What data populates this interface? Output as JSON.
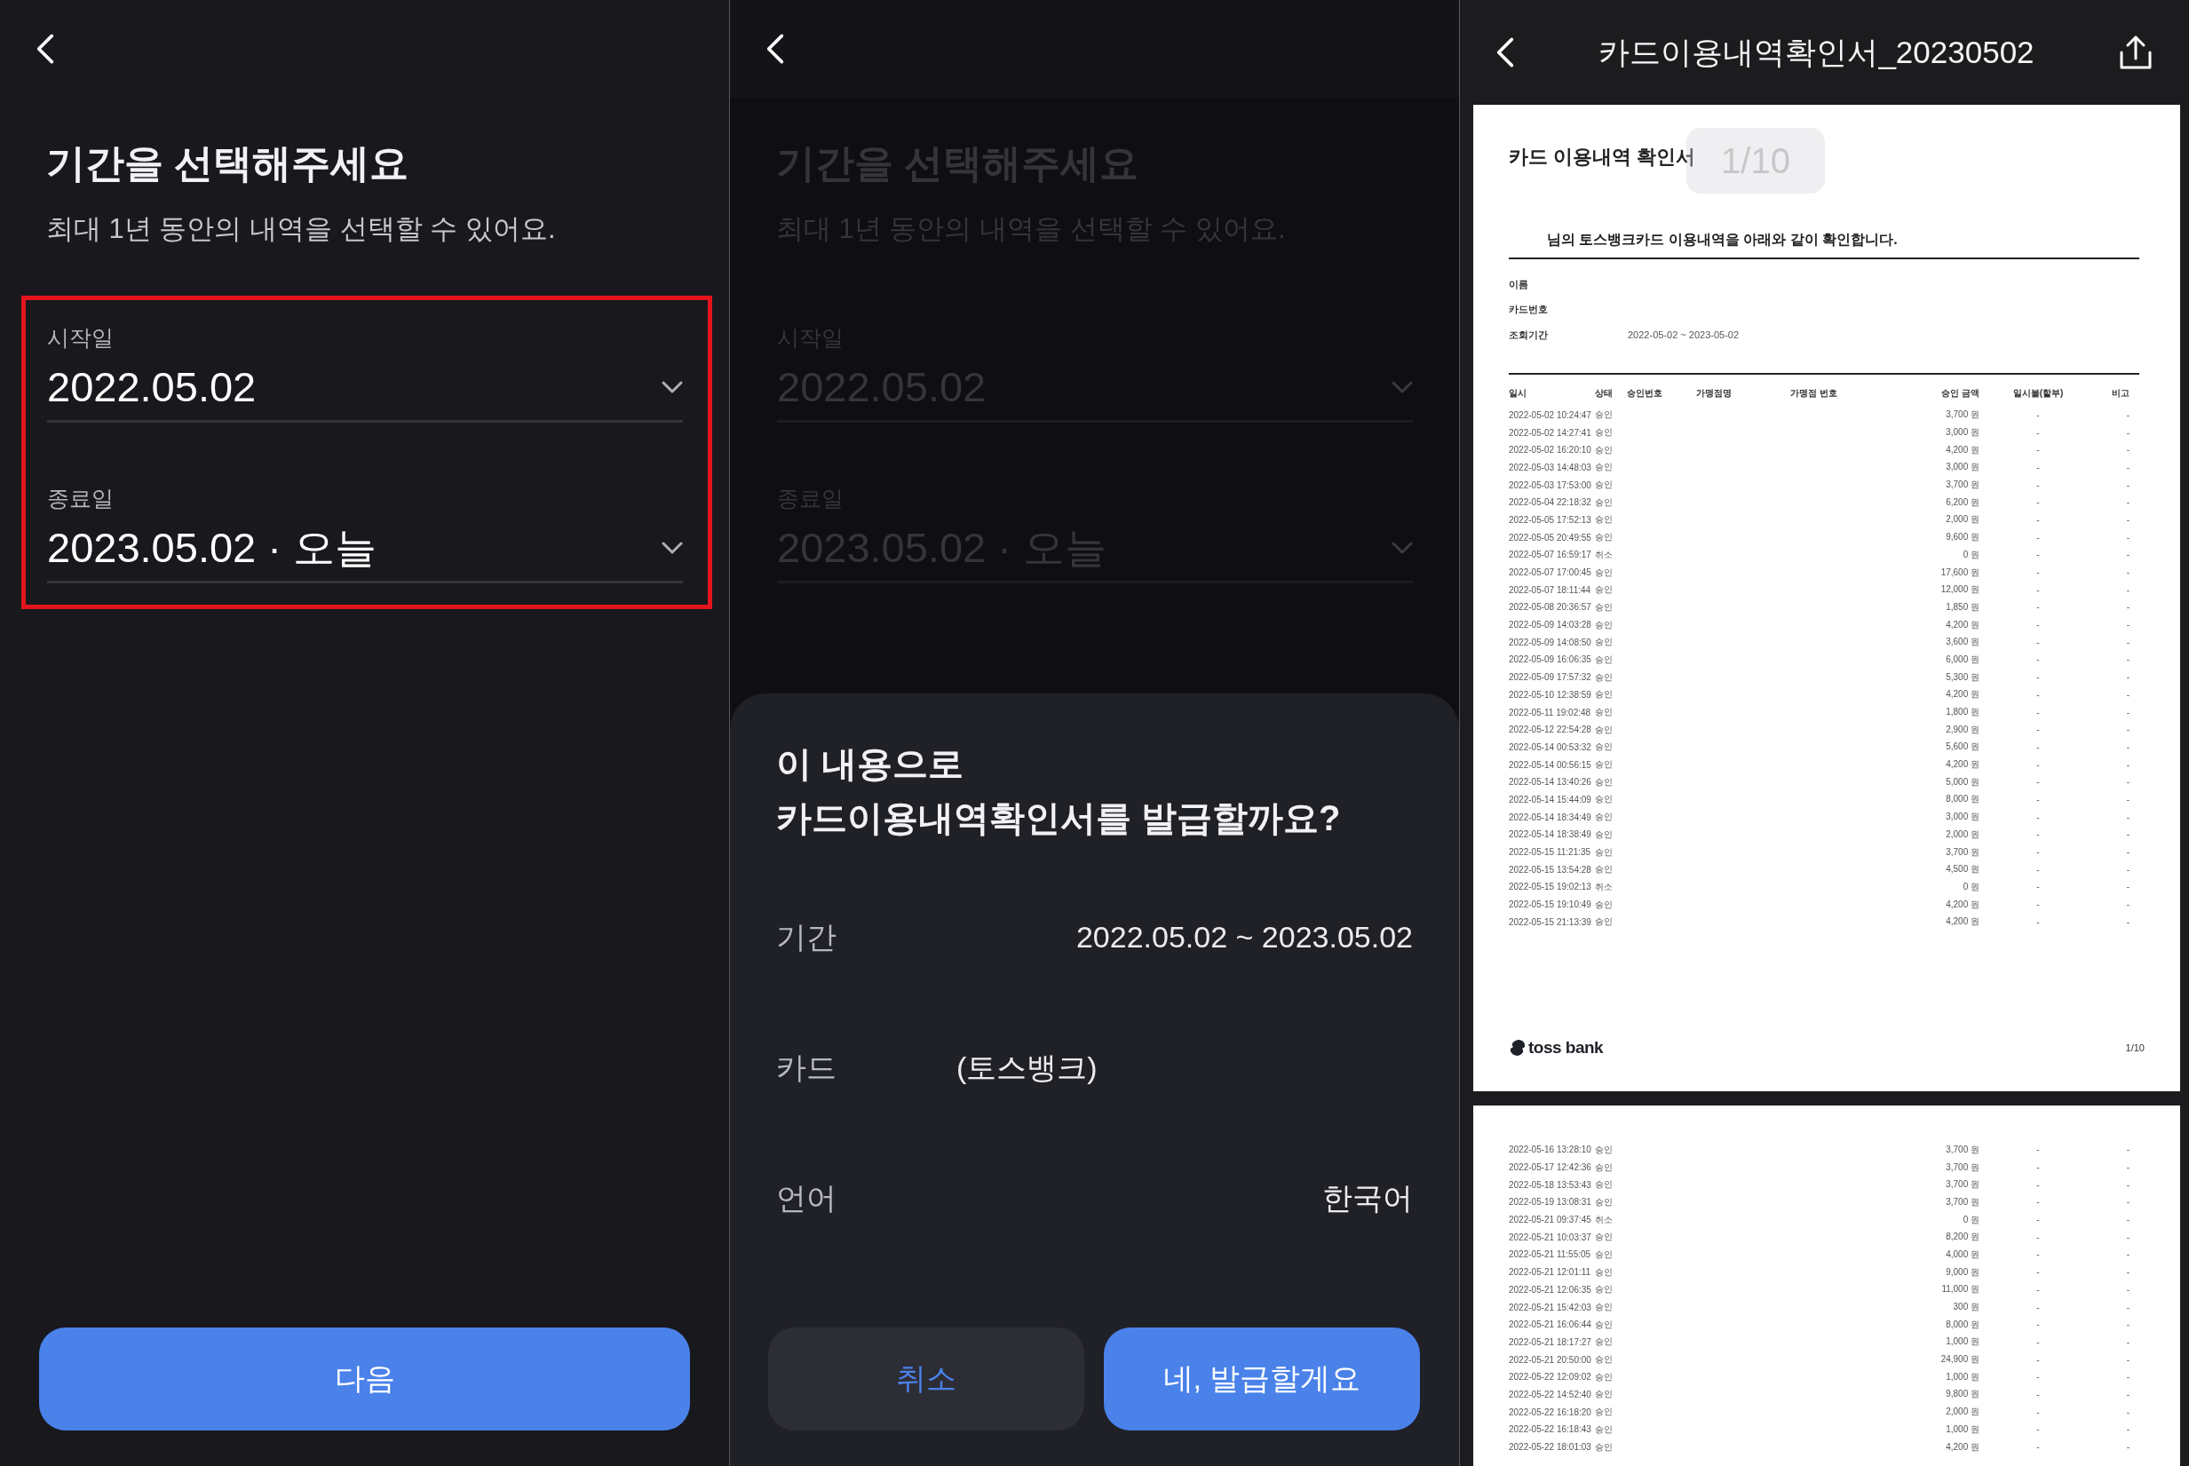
{
  "date_screen": {
    "title": "기간을 선택해주세요",
    "subtitle": "최대 1년 동안의 내역을 선택할 수 있어요.",
    "highlighted": true,
    "fields": [
      {
        "label": "시작일",
        "value": "2022.05.02"
      },
      {
        "label": "종료일",
        "value": "2023.05.02 · 오늘"
      }
    ],
    "next_button": "다음"
  },
  "confirm_screen": {
    "background": {
      "title": "기간을 선택해주세요",
      "subtitle": "최대 1년 동안의 내역을 선택할 수 있어요.",
      "fields": [
        {
          "label": "시작일",
          "value": "2022.05.02"
        },
        {
          "label": "종료일",
          "value": "2023.05.02 · 오늘"
        }
      ]
    },
    "sheet": {
      "title_lines": [
        "이 내용으로",
        "카드이용내역확인서를 발급할까요?"
      ],
      "rows": [
        {
          "kind": "plain",
          "label": "기간",
          "value": "2022.05.02 ~ 2023.05.02"
        },
        {
          "kind": "card",
          "label": "카드",
          "value": "(토스뱅크)"
        },
        {
          "kind": "plain",
          "label": "언어",
          "value": "한국어"
        }
      ],
      "buttons": [
        {
          "kind": "secondary",
          "label": "취소"
        },
        {
          "kind": "primary",
          "label": "네, 발급할게요"
        }
      ]
    }
  },
  "document_viewer": {
    "title": "카드이용내역확인서_20230502",
    "pages": [
      {
        "page_badge": "1/10",
        "heading": "카드 이용내역 확인서",
        "statement": "님의 토스뱅크카드 이용내역을 아래와 같이 확인합니다.",
        "info": [
          {
            "label": "이름"
          },
          {
            "label": "카드번호"
          },
          {
            "label": "조회기간",
            "value": "2022-05-02 ~ 2023-05-02"
          }
        ],
        "columns": [
          "일시",
          "상태",
          "승인번호",
          "가맹점명",
          "가맹점 번호",
          "승인 금액",
          "일시불(할부)",
          "비고"
        ],
        "rows": [
          {
            "time": "2022-05-02 10:24:47",
            "status": "승인",
            "amount": "3,700 원",
            "plan": "-",
            "note": "-"
          },
          {
            "time": "2022-05-02 14:27:41",
            "status": "승인",
            "amount": "3,000 원",
            "plan": "-",
            "note": "-"
          },
          {
            "time": "2022-05-02 16:20:10",
            "status": "승인",
            "amount": "4,200 원",
            "plan": "-",
            "note": "-"
          },
          {
            "time": "2022-05-03 14:48:03",
            "status": "승인",
            "amount": "3,000 원",
            "plan": "-",
            "note": "-"
          },
          {
            "time": "2022-05-03 17:53:00",
            "status": "승인",
            "amount": "3,700 원",
            "plan": "-",
            "note": "-"
          },
          {
            "time": "2022-05-04 22:18:32",
            "status": "승인",
            "amount": "6,200 원",
            "plan": "-",
            "note": "-"
          },
          {
            "time": "2022-05-05 17:52:13",
            "status": "승인",
            "amount": "2,000 원",
            "plan": "-",
            "note": "-"
          },
          {
            "time": "2022-05-05 20:49:55",
            "status": "승인",
            "amount": "9,600 원",
            "plan": "-",
            "note": "-"
          },
          {
            "time": "2022-05-07 16:59:17",
            "status": "취소",
            "amount": "0 원",
            "plan": "-",
            "note": "-"
          },
          {
            "time": "2022-05-07 17:00:45",
            "status": "승인",
            "amount": "17,600 원",
            "plan": "-",
            "note": "-"
          },
          {
            "time": "2022-05-07 18:11:44",
            "status": "승인",
            "amount": "12,000 원",
            "plan": "-",
            "note": "-"
          },
          {
            "time": "2022-05-08 20:36:57",
            "status": "승인",
            "amount": "1,850 원",
            "plan": "-",
            "note": "-"
          },
          {
            "time": "2022-05-09 14:03:28",
            "status": "승인",
            "amount": "4,200 원",
            "plan": "-",
            "note": "-"
          },
          {
            "time": "2022-05-09 14:08:50",
            "status": "승인",
            "amount": "3,600 원",
            "plan": "-",
            "note": "-"
          },
          {
            "time": "2022-05-09 16:06:35",
            "status": "승인",
            "amount": "6,000 원",
            "plan": "-",
            "note": "-"
          },
          {
            "time": "2022-05-09 17:57:32",
            "status": "승인",
            "amount": "5,300 원",
            "plan": "-",
            "note": "-"
          },
          {
            "time": "2022-05-10 12:38:59",
            "status": "승인",
            "amount": "4,200 원",
            "plan": "-",
            "note": "-"
          },
          {
            "time": "2022-05-11 19:02:48",
            "status": "승인",
            "amount": "1,800 원",
            "plan": "-",
            "note": "-"
          },
          {
            "time": "2022-05-12 22:54:28",
            "status": "승인",
            "amount": "2,900 원",
            "plan": "-",
            "note": "-"
          },
          {
            "time": "2022-05-14 00:53:32",
            "status": "승인",
            "amount": "5,600 원",
            "plan": "-",
            "note": "-"
          },
          {
            "time": "2022-05-14 00:56:15",
            "status": "승인",
            "amount": "4,200 원",
            "plan": "-",
            "note": "-"
          },
          {
            "time": "2022-05-14 13:40:26",
            "status": "승인",
            "amount": "5,000 원",
            "plan": "-",
            "note": "-"
          },
          {
            "time": "2022-05-14 15:44:09",
            "status": "승인",
            "amount": "8,000 원",
            "plan": "-",
            "note": "-"
          },
          {
            "time": "2022-05-14 18:34:49",
            "status": "승인",
            "amount": "3,000 원",
            "plan": "-",
            "note": "-"
          },
          {
            "time": "2022-05-14 18:38:49",
            "status": "승인",
            "amount": "2,000 원",
            "plan": "-",
            "note": "-"
          },
          {
            "time": "2022-05-15 11:21:35",
            "status": "승인",
            "amount": "3,700 원",
            "plan": "-",
            "note": "-"
          },
          {
            "time": "2022-05-15 13:54:28",
            "status": "승인",
            "amount": "4,500 원",
            "plan": "-",
            "note": "-"
          },
          {
            "time": "2022-05-15 19:02:13",
            "status": "취소",
            "amount": "0 원",
            "plan": "-",
            "note": "-"
          },
          {
            "time": "2022-05-15 19:10:49",
            "status": "승인",
            "amount": "4,200 원",
            "plan": "-",
            "note": "-"
          },
          {
            "time": "2022-05-15 21:13:39",
            "status": "승인",
            "amount": "4,200 원",
            "plan": "-",
            "note": "-"
          }
        ],
        "footer": {
          "brand": "toss bank",
          "page_number": "1/10"
        }
      },
      {
        "rows": [
          {
            "time": "2022-05-16 13:28:10",
            "status": "승인",
            "amount": "3,700 원",
            "plan": "-",
            "note": "-"
          },
          {
            "time": "2022-05-17 12:42:36",
            "status": "승인",
            "amount": "3,700 원",
            "plan": "-",
            "note": "-"
          },
          {
            "time": "2022-05-18 13:53:43",
            "status": "승인",
            "amount": "3,700 원",
            "plan": "-",
            "note": "-"
          },
          {
            "time": "2022-05-19 13:08:31",
            "status": "승인",
            "amount": "3,700 원",
            "plan": "-",
            "note": "-"
          },
          {
            "time": "2022-05-21 09:37:45",
            "status": "취소",
            "amount": "0 원",
            "plan": "-",
            "note": "-"
          },
          {
            "time": "2022-05-21 10:03:37",
            "status": "승인",
            "amount": "8,200 원",
            "plan": "-",
            "note": "-"
          },
          {
            "time": "2022-05-21 11:55:05",
            "status": "승인",
            "amount": "4,000 원",
            "plan": "-",
            "note": "-"
          },
          {
            "time": "2022-05-21 12:01:11",
            "status": "승인",
            "amount": "9,000 원",
            "plan": "-",
            "note": "-"
          },
          {
            "time": "2022-05-21 12:06:35",
            "status": "승인",
            "amount": "11,000 원",
            "plan": "-",
            "note": "-"
          },
          {
            "time": "2022-05-21 15:42:03",
            "status": "승인",
            "amount": "300 원",
            "plan": "-",
            "note": "-"
          },
          {
            "time": "2022-05-21 16:06:44",
            "status": "승인",
            "amount": "8,000 원",
            "plan": "-",
            "note": "-"
          },
          {
            "time": "2022-05-21 18:17:27",
            "status": "승인",
            "amount": "1,000 원",
            "plan": "-",
            "note": "-"
          },
          {
            "time": "2022-05-21 20:50:00",
            "status": "승인",
            "amount": "24,900 원",
            "plan": "-",
            "note": "-"
          },
          {
            "time": "2022-05-22 12:09:02",
            "status": "승인",
            "amount": "1,000 원",
            "plan": "-",
            "note": "-"
          },
          {
            "time": "2022-05-22 14:52:40",
            "status": "승인",
            "amount": "9,800 원",
            "plan": "-",
            "note": "-"
          },
          {
            "time": "2022-05-22 16:18:20",
            "status": "승인",
            "amount": "2,000 원",
            "plan": "-",
            "note": "-"
          },
          {
            "time": "2022-05-22 16:18:43",
            "status": "승인",
            "amount": "1,000 원",
            "plan": "-",
            "note": "-"
          },
          {
            "time": "2022-05-22 18:01:03",
            "status": "승인",
            "amount": "4,200 원",
            "plan": "-",
            "note": "-"
          }
        ]
      }
    ]
  }
}
